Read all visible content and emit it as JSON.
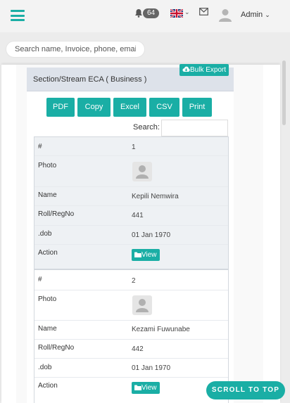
{
  "header": {
    "notification_count": "64",
    "user_label": "Admin"
  },
  "global_search": {
    "placeholder": "Search name, Invoice, phone, email"
  },
  "panel": {
    "title": "Section/Stream ECA ( Business )",
    "bulk_export_label": "Bulk Export",
    "export_buttons": [
      "PDF",
      "Copy",
      "Excel",
      "CSV",
      "Print"
    ],
    "search_label": "Search:"
  },
  "fields": {
    "num": "#",
    "photo": "Photo",
    "name": "Name",
    "roll": "Roll/RegNo",
    "dob": ".dob",
    "action": "Action"
  },
  "records": [
    {
      "num": "1",
      "name": "Kepili Nemwira",
      "roll": "441",
      "dob": "01 Jan 1970",
      "action_label": "View"
    },
    {
      "num": "2",
      "name": "Kezami Fuwunabe",
      "roll": "442",
      "dob": "01 Jan 1970",
      "action_label": "View"
    }
  ],
  "scroll_top_label": "SCROLL TO TOP",
  "colors": {
    "accent": "#1aaea5",
    "panel_header": "#dde2ea",
    "first_card_bg": "#eef1f4"
  },
  "icons": [
    "hamburger-icon",
    "bell-icon",
    "uk-flag-icon",
    "chevron-down-icon",
    "mail-icon",
    "user-avatar-icon",
    "cloud-download-icon",
    "folder-icon",
    "person-placeholder-icon"
  ]
}
